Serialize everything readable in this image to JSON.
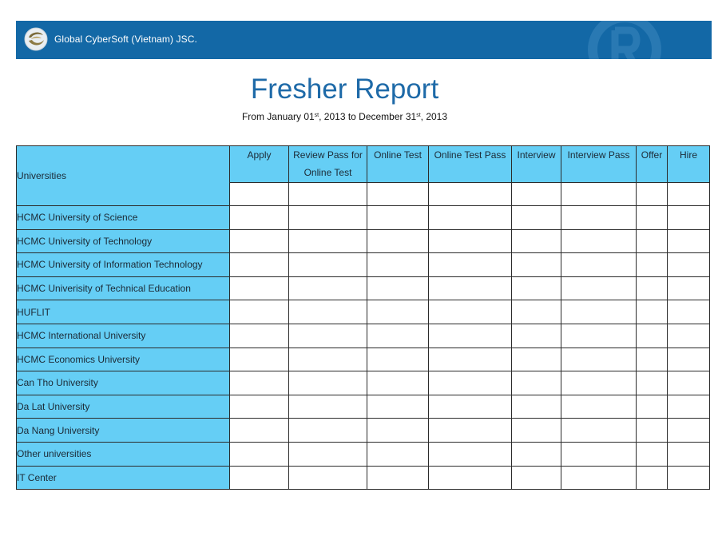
{
  "header": {
    "company_name": "Global CyberSoft (Vietnam) JSC.",
    "logo_icon": "gcs-swirl-logo-icon",
    "watermark_icon": "r-watermark-icon",
    "background_color": "#1368a6"
  },
  "report": {
    "title": "Fresher Report",
    "subtitle_prefix": "From January 01",
    "subtitle_sup_1": "st",
    "subtitle_middle": ", 2013 to December 31",
    "subtitle_sup_2": "st",
    "subtitle_suffix": ", 2013"
  },
  "table": {
    "header_color": "#65cef5",
    "row_header": "Universities",
    "columns": [
      "Apply",
      "Review Pass for Online Test",
      "Online Test",
      "Online Test Pass",
      "Interview",
      "Interview Pass",
      "Offer",
      "Hire"
    ],
    "rows": [
      "HCMC University of Science",
      "HCMC University of Technology",
      "HCMC University of Information Technology",
      "HCMC Univerisity of Technical Education",
      "HUFLIT",
      "HCMC International University",
      "HCMC Economics University",
      "Can Tho University",
      "Da Lat University",
      "Da Nang University",
      "Other universities",
      "IT Center"
    ]
  }
}
